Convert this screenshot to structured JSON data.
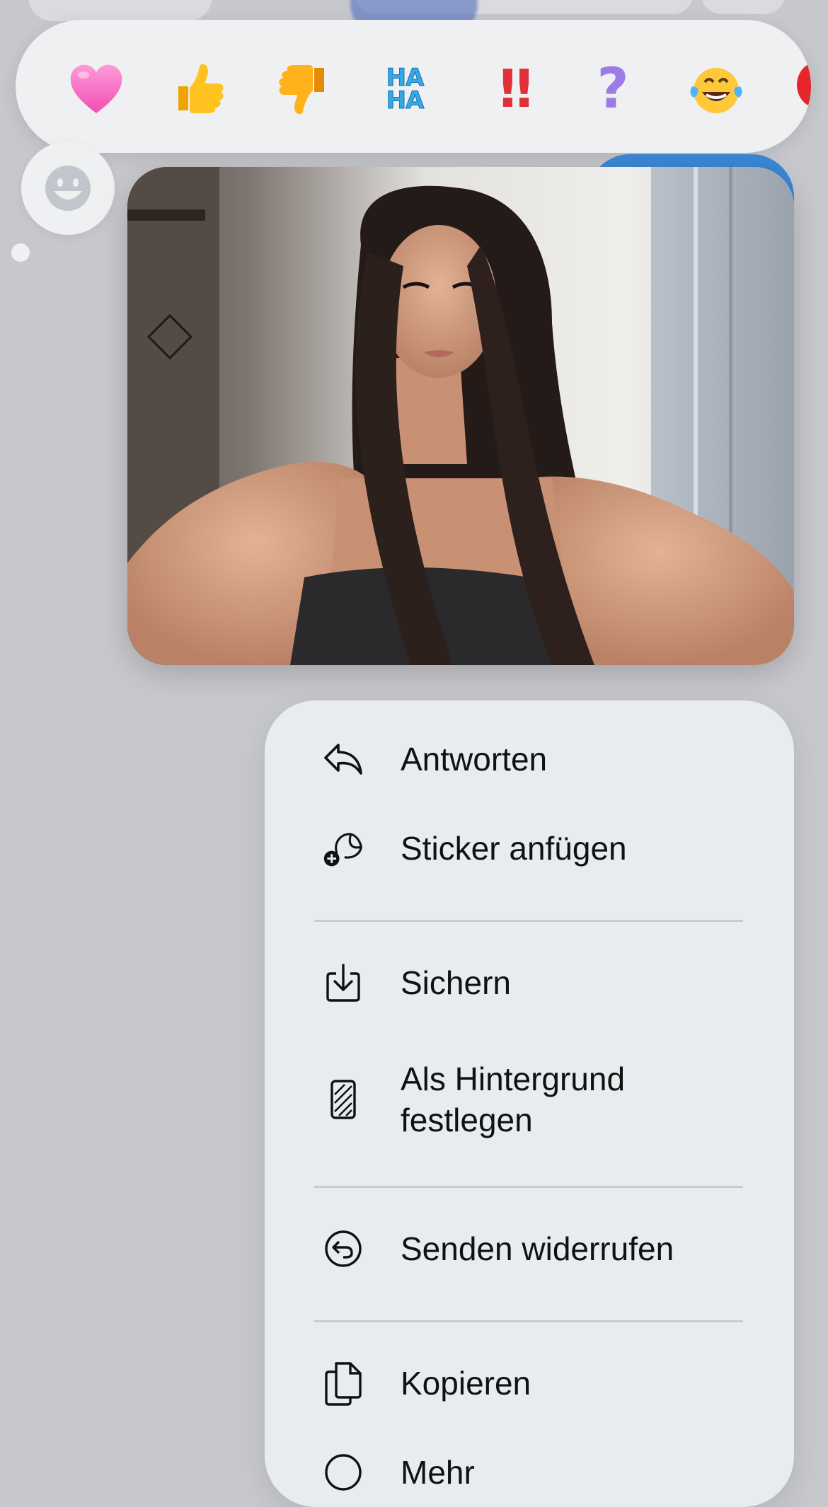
{
  "reactions": {
    "items": [
      {
        "name": "heart",
        "glyph": "❤"
      },
      {
        "name": "thumbs-up",
        "glyph": "👍"
      },
      {
        "name": "thumbs-down",
        "glyph": "👎"
      },
      {
        "name": "haha",
        "glyph": "HA HA"
      },
      {
        "name": "exclamation",
        "glyph": "‼"
      },
      {
        "name": "question",
        "glyph": "?"
      },
      {
        "name": "laughing",
        "glyph": "😂"
      },
      {
        "name": "balloon",
        "glyph": "🎈"
      }
    ],
    "emoji_picker_icon": "smiley-face-icon"
  },
  "message": {
    "image": "selfie-photo"
  },
  "menu": {
    "items": [
      {
        "label": "Antworten",
        "icon": "reply-icon"
      },
      {
        "label": "Sticker anfügen",
        "icon": "sticker-add-icon"
      },
      {
        "label": "Sichern",
        "icon": "save-icon"
      },
      {
        "label": "Als Hintergrund",
        "label_line2": "festlegen",
        "icon": "wallpaper-icon"
      },
      {
        "label": "Senden widerrufen",
        "icon": "undo-send-icon"
      },
      {
        "label": "Kopieren",
        "icon": "copy-icon"
      },
      {
        "label": "Mehr",
        "icon": "more-icon"
      }
    ]
  },
  "colors": {
    "background": "#c7c8cd",
    "panel": "#e8ecee",
    "text": "#111111",
    "accent_blue": "#3b86d4"
  }
}
